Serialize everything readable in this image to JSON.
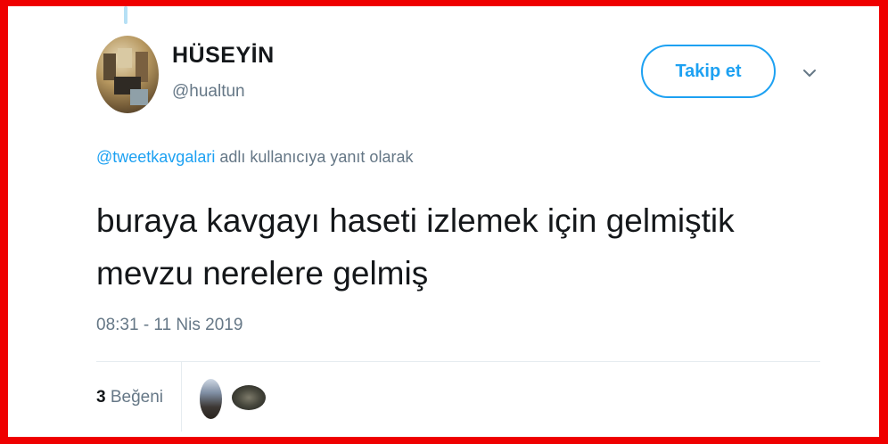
{
  "user": {
    "name": "HÜSEYİN",
    "handle": "@hualtun"
  },
  "follow_button": {
    "label": "Takip et"
  },
  "reply_context": {
    "mention": "@tweetkavgalari",
    "text": " adlı kullanıcıya yanıt olarak"
  },
  "tweet": {
    "line1": "buraya kavgayı haseti izlemek için gelmiştik",
    "line2": "mevzu nerelere gelmiş",
    "timestamp": "08:31 - 11 Nis 2019"
  },
  "stats": {
    "likes_count": "3",
    "likes_label": " Beğeni"
  },
  "colors": {
    "accent": "#1da1f2",
    "frame": "#ef0000",
    "secondary_text": "#657786",
    "primary_text": "#14171a"
  },
  "icons": {
    "menu": "chevron-down-icon"
  }
}
